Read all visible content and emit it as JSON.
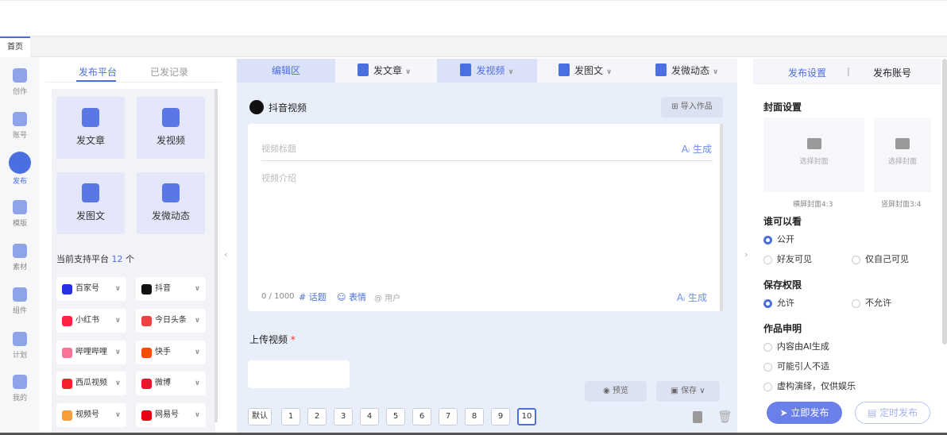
{
  "top_tab": {
    "label": "首页"
  },
  "rail": [
    {
      "label": "创作",
      "icon": "pen-icon"
    },
    {
      "label": "账号",
      "icon": "users-icon"
    },
    {
      "label": "发布",
      "icon": "publish-icon",
      "active": true
    },
    {
      "label": "模版",
      "icon": "layers-icon"
    },
    {
      "label": "素材",
      "icon": "cloud-icon"
    },
    {
      "label": "组件",
      "icon": "puzzle-icon"
    },
    {
      "label": "计划",
      "icon": "calendar-icon"
    },
    {
      "label": "我的",
      "icon": "user-icon"
    }
  ],
  "left": {
    "tabs": [
      "发布平台",
      "已发记录"
    ],
    "cards": [
      "发文章",
      "发视频",
      "发图文",
      "发微动态"
    ],
    "support_prefix": "当前支持平台",
    "support_count": "12",
    "support_suffix": "个",
    "platforms": [
      {
        "name": "百家号",
        "color": "#2932e1"
      },
      {
        "name": "抖音",
        "color": "#111111"
      },
      {
        "name": "小红书",
        "color": "#ff2442"
      },
      {
        "name": "今日头条",
        "color": "#f04142"
      },
      {
        "name": "哔哩哔哩",
        "color": "#fb7299"
      },
      {
        "name": "快手",
        "color": "#ff4906"
      },
      {
        "name": "西瓜视频",
        "color": "#f5222d"
      },
      {
        "name": "微博",
        "color": "#e6162d"
      },
      {
        "name": "视频号",
        "color": "#fa9d3b"
      },
      {
        "name": "网易号",
        "color": "#e60012"
      }
    ]
  },
  "editor": {
    "tabs": {
      "edit": "编辑区",
      "article": "发文章",
      "video": "发视频",
      "image": "发图文",
      "micro": "发微动态"
    },
    "platform": "抖音视频",
    "import": "导入作品",
    "title_ph": "视频标题",
    "ai_gen": "生成",
    "intro_ph": "视频介绍",
    "counter": "0 / 1000",
    "topic": "话题",
    "emoji": "表情",
    "user": "用户",
    "upload": "上传视频",
    "required": "*",
    "preview": "预览",
    "save": "保存",
    "pages": [
      "默认",
      "1",
      "2",
      "3",
      "4",
      "5",
      "6",
      "7",
      "8",
      "9",
      "10"
    ],
    "active_page": "10"
  },
  "right": {
    "tabs": [
      "发布设置",
      "发布账号"
    ],
    "cover_title": "封面设置",
    "cover_btn": "选择封面",
    "cover_h": "横屏封面4:3",
    "cover_v": "竖屏封面3:4",
    "visible_title": "谁可以看",
    "visible": [
      "公开",
      "好友可见",
      "仅自己可见"
    ],
    "save_title": "保存权限",
    "save_opts": [
      "允许",
      "不允许"
    ],
    "declare_title": "作品申明",
    "declares": [
      "内容由AI生成",
      "可能引人不适",
      "虚构演绎，仅供娱乐"
    ],
    "publish": "立即发布",
    "schedule": "定时发布"
  },
  "colors": {
    "accent": "#4b6ee0"
  }
}
